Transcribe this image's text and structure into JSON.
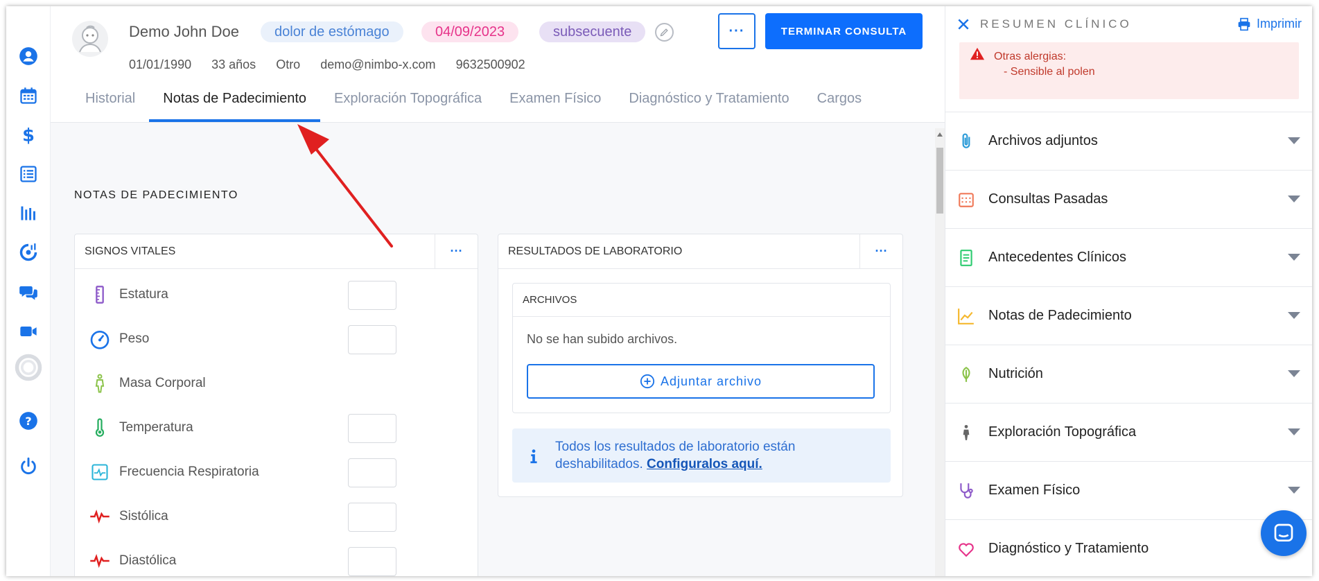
{
  "patient": {
    "name": "Demo John Doe",
    "birthdate": "01/01/1990",
    "age": "33 años",
    "gender": "Otro",
    "email": "demo@nimbo-x.com",
    "phone": "9632500902"
  },
  "badges": {
    "reason": "dolor de estómago",
    "date": "04/09/2023",
    "type": "subsecuente"
  },
  "header": {
    "more_label": "···",
    "end_button": "TERMINAR CONSULTA"
  },
  "tabs": [
    {
      "label": "Historial"
    },
    {
      "label": "Notas de Padecimiento"
    },
    {
      "label": "Exploración Topográfica"
    },
    {
      "label": "Examen Físico"
    },
    {
      "label": "Diagnóstico y Tratamiento"
    },
    {
      "label": "Cargos"
    }
  ],
  "section_title": "NOTAS DE PADECIMIENTO",
  "vitals": {
    "title": "SIGNOS VITALES",
    "more_label": "···",
    "items": [
      {
        "label": "Estatura"
      },
      {
        "label": "Peso"
      },
      {
        "label": "Masa Corporal"
      },
      {
        "label": "Temperatura"
      },
      {
        "label": "Frecuencia Respiratoria"
      },
      {
        "label": "Sistólica"
      },
      {
        "label": "Diastólica"
      }
    ]
  },
  "lab": {
    "title": "RESULTADOS DE LABORATORIO",
    "more_label": "···",
    "files_title": "ARCHIVOS",
    "empty_text": "No se han subido archivos.",
    "attach_label": "Adjuntar archivo",
    "info_text": "Todos los resultados de laboratorio están deshabilitados.",
    "info_link": "Configuralos aquí."
  },
  "right_panel": {
    "title": "RESUMEN CLÍNICO",
    "print_label": "Imprimir",
    "allergy_title": "Otras alergias:",
    "allergy_item": "- Sensible al polen",
    "sections": [
      {
        "label": "Archivos adjuntos",
        "icon": "paperclip-icon",
        "color": "#2b9bd8"
      },
      {
        "label": "Consultas Pasadas",
        "icon": "calendar-icon",
        "color": "#f07a5a"
      },
      {
        "label": "Antecedentes Clínicos",
        "icon": "document-icon",
        "color": "#2ecc71"
      },
      {
        "label": "Notas de Padecimiento",
        "icon": "chart-line-icon",
        "color": "#f5b82e"
      },
      {
        "label": "Nutrición",
        "icon": "leaf-icon",
        "color": "#8bc34a"
      },
      {
        "label": "Exploración Topográfica",
        "icon": "body-icon",
        "color": "#555"
      },
      {
        "label": "Examen Físico",
        "icon": "stethoscope-icon",
        "color": "#8e5bc9"
      },
      {
        "label": "Diagnóstico y Tratamiento",
        "icon": "heart-icon",
        "color": "#e6338a"
      }
    ]
  },
  "colors": {
    "primary": "#0d6efd",
    "sidebar_icon": "#1a73e8",
    "annotation_arrow": "#e02020"
  }
}
